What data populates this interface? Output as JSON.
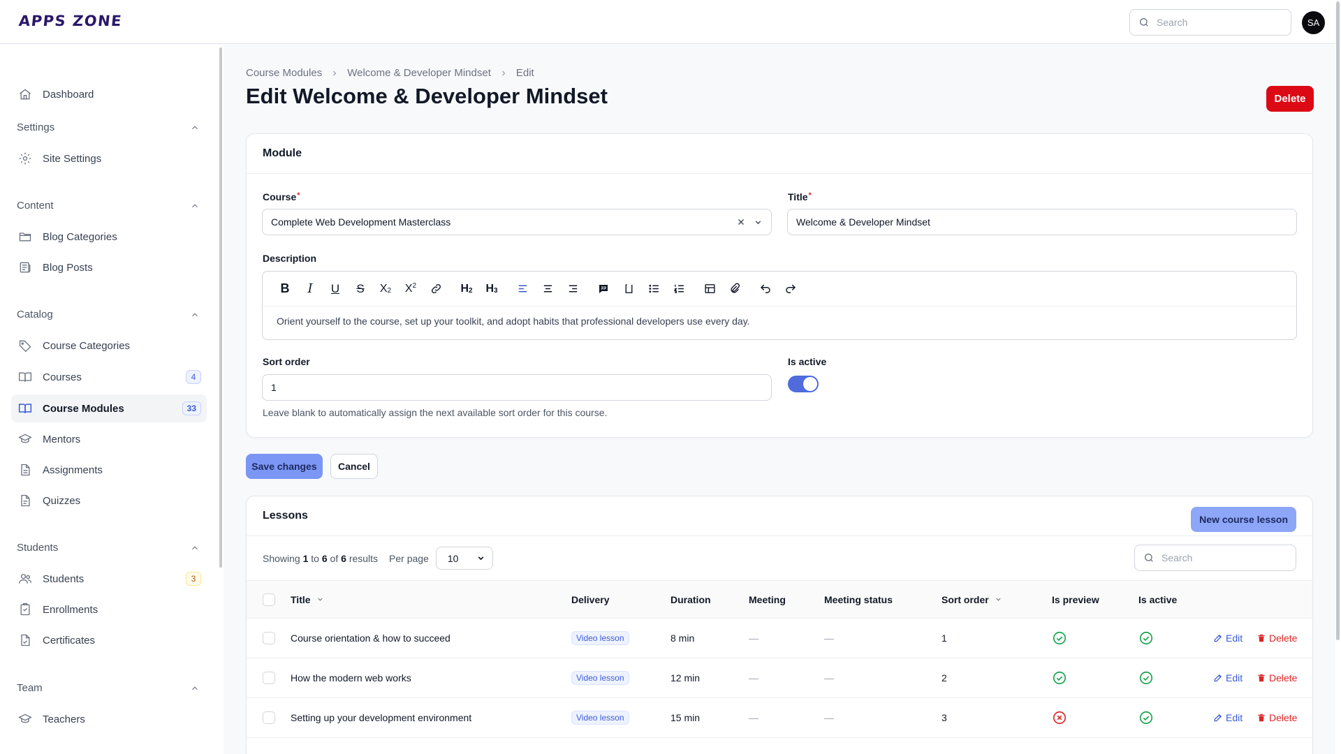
{
  "app": {
    "logo": "APPS ZONE",
    "avatar_initials": "SA",
    "search_placeholder": "Search"
  },
  "sidebar": {
    "dashboard": "Dashboard",
    "groups": {
      "settings": "Settings",
      "content": "Content",
      "catalog": "Catalog",
      "students": "Students",
      "team": "Team"
    },
    "items": {
      "site_settings": "Site Settings",
      "blog_categories": "Blog Categories",
      "blog_posts": "Blog Posts",
      "course_categories": "Course Categories",
      "courses": "Courses",
      "courses_count": "4",
      "course_modules": "Course Modules",
      "course_modules_count": "33",
      "mentors": "Mentors",
      "assignments": "Assignments",
      "quizzes": "Quizzes",
      "students": "Students",
      "students_count": "3",
      "enrollments": "Enrollments",
      "certificates": "Certificates",
      "teachers": "Teachers"
    }
  },
  "breadcrumb": [
    "Course Modules",
    "Welcome & Developer Mindset",
    "Edit"
  ],
  "page": {
    "title": "Edit Welcome & Developer Mindset",
    "delete_label": "Delete"
  },
  "module_form": {
    "section_title": "Module",
    "course_label": "Course",
    "course_value": "Complete Web Development Masterclass",
    "title_label": "Title",
    "title_value": "Welcome & Developer Mindset",
    "description_label": "Description",
    "description_value": "Orient yourself to the course, set up your toolkit, and adopt habits that professional developers use every day.",
    "sort_order_label": "Sort order",
    "sort_order_value": "1",
    "sort_order_hint": "Leave blank to automatically assign the next available sort order for this course.",
    "is_active_label": "Is active",
    "is_active": true
  },
  "actions": {
    "save": "Save changes",
    "cancel": "Cancel"
  },
  "lessons": {
    "section_title": "Lessons",
    "new_button": "New course lesson",
    "showing_prefix": "Showing",
    "showing_from": "1",
    "showing_to_word": "to",
    "showing_to": "6",
    "showing_of_word": "of",
    "showing_total": "6",
    "showing_suffix": "results",
    "per_page_label": "Per page",
    "per_page_value": "10",
    "search_placeholder": "Search",
    "columns": [
      "Title",
      "Delivery",
      "Duration",
      "Meeting",
      "Meeting status",
      "Sort order",
      "Is preview",
      "Is active"
    ],
    "edit_label": "Edit",
    "delete_label": "Delete",
    "rows": [
      {
        "title": "Course orientation & how to succeed",
        "delivery": "Video lesson",
        "duration": "8 min",
        "meeting": "—",
        "meeting_status": "—",
        "sort_order": "1",
        "is_preview": true,
        "is_active": true
      },
      {
        "title": "How the modern web works",
        "delivery": "Video lesson",
        "duration": "12 min",
        "meeting": "—",
        "meeting_status": "—",
        "sort_order": "2",
        "is_preview": true,
        "is_active": true
      },
      {
        "title": "Setting up your development environment",
        "delivery": "Video lesson",
        "duration": "15 min",
        "meeting": "—",
        "meeting_status": "—",
        "sort_order": "3",
        "is_preview": false,
        "is_active": true
      }
    ]
  },
  "colors": {
    "accent": "#3b5bd6",
    "danger": "#dc0a14",
    "success": "#16a34a",
    "brand": "#2a1769"
  }
}
